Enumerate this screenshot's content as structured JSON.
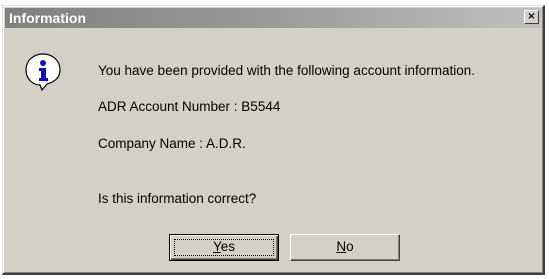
{
  "window": {
    "title": "Information",
    "close_glyph": "×"
  },
  "icon": "information-icon",
  "message": {
    "line1": "You have been provided with the following account information.",
    "account_number": "ADR Account Number : B5544",
    "company_name": "Company Name : A.D.R.",
    "question": "Is this information correct?"
  },
  "buttons": {
    "yes": {
      "accel": "Y",
      "rest": "es"
    },
    "no": {
      "accel": "N",
      "rest": "o"
    }
  }
}
